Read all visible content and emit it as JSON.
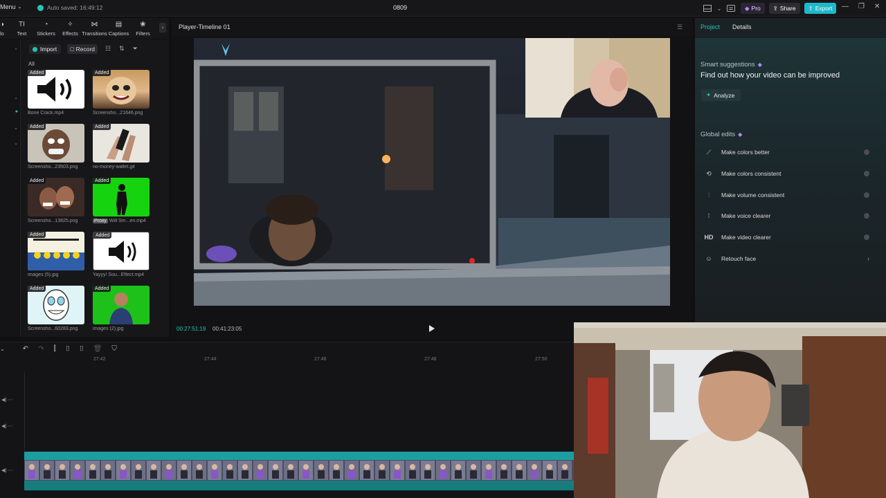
{
  "titlebar": {
    "menu_label": "Menu",
    "autosave_text": "Auto saved: 16:49:12",
    "project_name": "0809",
    "pro_label": "Pro",
    "share_label": "Share",
    "export_label": "Export"
  },
  "toolbar": {
    "tabs": [
      {
        "label": "lo",
        "icon": "audio-icon"
      },
      {
        "label": "Text",
        "icon": "text-icon"
      },
      {
        "label": "Stickers",
        "icon": "sticker-icon"
      },
      {
        "label": "Effects",
        "icon": "effects-icon"
      },
      {
        "label": "Transitions",
        "icon": "transitions-icon"
      },
      {
        "label": "Captions",
        "icon": "captions-icon"
      },
      {
        "label": "Filters",
        "icon": "filters-icon"
      }
    ]
  },
  "media": {
    "import_label": "Import",
    "record_label": "Record",
    "filter_label": "All",
    "items": [
      {
        "tag": "Added",
        "name": "Bone Crack.mp4",
        "proxy": ""
      },
      {
        "tag": "Added",
        "name": "Screensho...21646.png",
        "proxy": ""
      },
      {
        "tag": "Added",
        "name": "Screensho...23503.png",
        "proxy": ""
      },
      {
        "tag": "Added",
        "name": "no-money-wallet.gif",
        "proxy": ""
      },
      {
        "tag": "Added",
        "name": "Screensho...13825.png",
        "proxy": ""
      },
      {
        "tag": "Added",
        "name": "Will Sm...en.mp4",
        "proxy": "Proxy"
      },
      {
        "tag": "Added",
        "name": "images (5).jpg",
        "proxy": ""
      },
      {
        "tag": "Added",
        "name": "Yayyy! Sou...Effect.mp4",
        "proxy": ""
      },
      {
        "tag": "Added",
        "name": "Screensho...60283.png",
        "proxy": ""
      },
      {
        "tag": "Added",
        "name": "images (2).jpg",
        "proxy": ""
      }
    ]
  },
  "player": {
    "title": "Player-Timeline 01",
    "time_current": "00:27:51:19",
    "time_total": "00:41:23:05"
  },
  "right_panel": {
    "tab_project": "Project",
    "tab_details": "Details",
    "smart_label": "Smart suggestions",
    "smart_title": "Find out how your video can be improved",
    "analyze_label": "Analyze",
    "global_label": "Global edits",
    "edits": [
      {
        "label": "Make colors better",
        "icon": "color-wand-icon",
        "kind": "toggle"
      },
      {
        "label": "Make colors consistent",
        "icon": "color-match-icon",
        "kind": "toggle"
      },
      {
        "label": "Make volume consistent",
        "icon": "volume-eq-icon",
        "kind": "toggle"
      },
      {
        "label": "Make voice clearer",
        "icon": "voice-icon",
        "kind": "toggle"
      },
      {
        "label": "Make video clearer",
        "icon": "hd-icon",
        "kind": "toggle"
      },
      {
        "label": "Retouch face",
        "icon": "retouch-icon",
        "kind": "arrow"
      }
    ]
  },
  "timeline": {
    "ticks": [
      "27:42",
      "27:44",
      "27:46",
      "27:48",
      "27:50"
    ]
  },
  "colors": {
    "accent": "#27c4b3",
    "export": "#1fb8c8",
    "clip": "#1c9ea0"
  }
}
